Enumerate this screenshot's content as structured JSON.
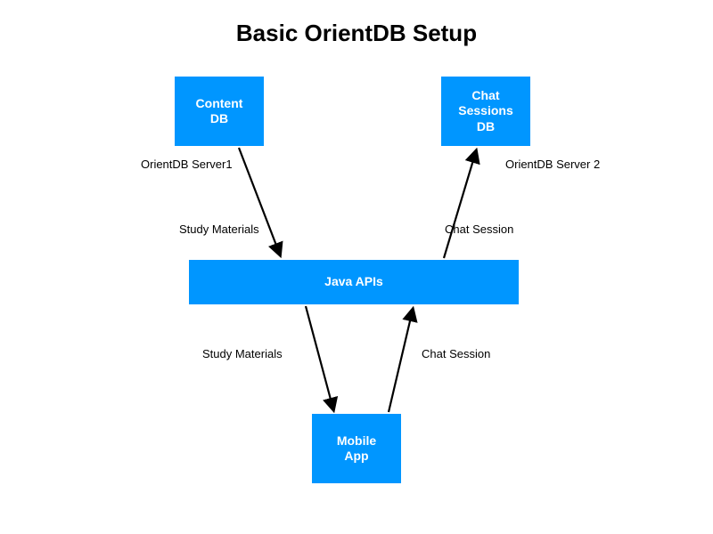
{
  "title": "Basic OrientDB Setup",
  "nodes": {
    "contentDb": "Content\nDB",
    "chatSessionsDb": "Chat\nSessions\nDB",
    "javaApis": "Java APIs",
    "mobileApp": "Mobile\nApp"
  },
  "labels": {
    "server1": "OrientDB Server1",
    "studyMaterials1": "Study Materials",
    "chatSession1": "Chat Session",
    "server2": "OrientDB Server 2",
    "studyMaterials2": "Study Materials",
    "chatSession2": "Chat Session"
  },
  "colors": {
    "node": "#0096ff",
    "arrow": "#000000"
  }
}
